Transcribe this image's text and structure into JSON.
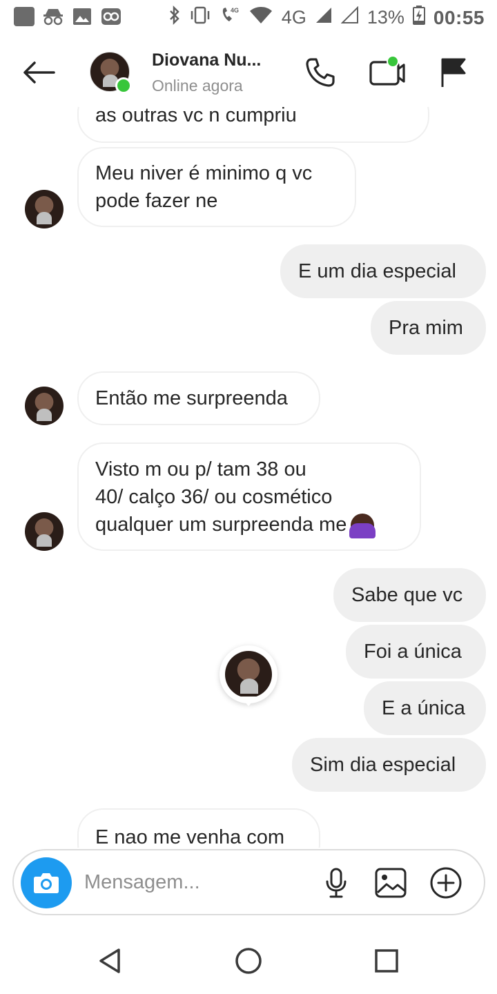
{
  "status_bar": {
    "network": "4G",
    "battery": "13%",
    "time": "00:55"
  },
  "header": {
    "contact_name": "Diovana Nu...",
    "presence": "Online agora"
  },
  "messages": [
    {
      "dir": "in",
      "text": "as outras vc n cumpriu"
    },
    {
      "dir": "in",
      "text_lines": [
        "Meu niver é minimo q vc",
        "pode fazer ne"
      ]
    },
    {
      "dir": "out",
      "text": "E um dia especial"
    },
    {
      "dir": "out",
      "text": "Pra mim"
    },
    {
      "dir": "in",
      "text": "Então me surpreenda"
    },
    {
      "dir": "in",
      "text_lines": [
        "Visto m ou p/ tam 38 ou",
        "40/ calço 36/ ou cosmético",
        "qualquer um surpreenda me"
      ],
      "emoji": "person-gesturing-no"
    },
    {
      "dir": "out",
      "text": "Sabe que vc"
    },
    {
      "dir": "out",
      "text": "Foi a única"
    },
    {
      "dir": "out",
      "text": "E a única"
    },
    {
      "dir": "out",
      "text": "Sim dia especial"
    },
    {
      "dir": "in",
      "text": "E nao me venha com"
    }
  ],
  "composer": {
    "placeholder": "Mensagem..."
  },
  "colors": {
    "accent": "#1d9bf0",
    "online": "#38c63b",
    "outgoing_bubble": "#efefef"
  }
}
